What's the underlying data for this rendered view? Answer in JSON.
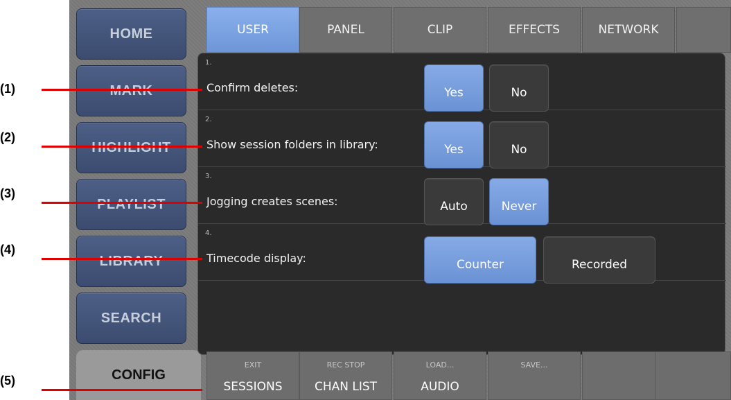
{
  "nav": {
    "home": "HOME",
    "mark": "MARK",
    "highlight": "HIGHLIGHT",
    "playlist": "PLAYLIST",
    "library": "LIBRARY",
    "search": "SEARCH",
    "config": "CONFIG"
  },
  "tabs": [
    "USER",
    "PANEL",
    "CLIP",
    "EFFECTS",
    "NETWORK"
  ],
  "active_tab": "USER",
  "settings": [
    {
      "num": "1.",
      "label": "Confirm deletes:",
      "options": [
        "Yes",
        "No"
      ],
      "selected": "Yes"
    },
    {
      "num": "2.",
      "label": "Show session folders in library:",
      "options": [
        "Yes",
        "No"
      ],
      "selected": "Yes"
    },
    {
      "num": "3.",
      "label": "Jogging creates scenes:",
      "options": [
        "Auto",
        "Never"
      ],
      "selected": "Never"
    },
    {
      "num": "4.",
      "label": "Timecode display:",
      "options": [
        "Counter",
        "Recorded"
      ],
      "selected": "Counter"
    }
  ],
  "bottom_buttons": [
    {
      "small": "EXIT",
      "big": "SESSIONS"
    },
    {
      "small": "REC STOP",
      "big": "CHAN LIST"
    },
    {
      "small": "LOAD...",
      "big": "AUDIO"
    },
    {
      "small": "SAVE...",
      "big": ""
    },
    {
      "small": "",
      "big": ""
    },
    {
      "small": "",
      "big": ""
    }
  ],
  "callouts": [
    "(1)",
    "(2)",
    "(3)",
    "(4)",
    "(5)"
  ],
  "colors": {
    "active_blue": "#7aa0e0",
    "callout_line": "#dd0000",
    "nav_blue": "#44557a"
  }
}
